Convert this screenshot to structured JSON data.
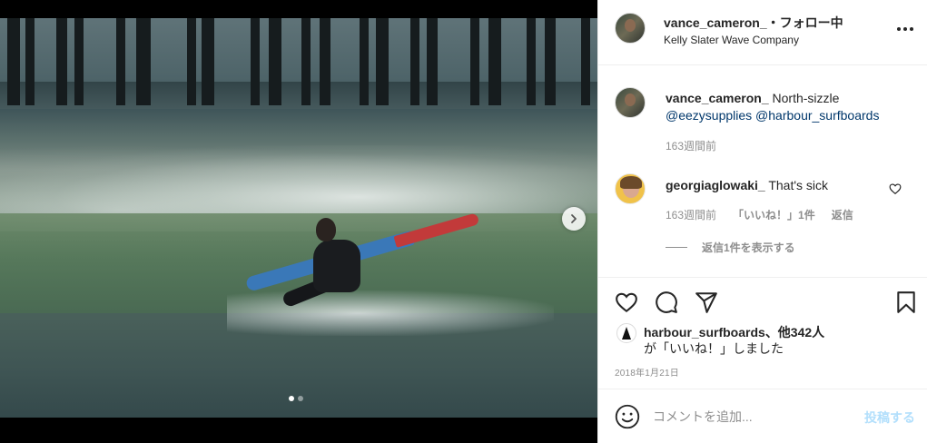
{
  "post": {
    "username": "vance_cameron_",
    "follow_status": "・フォロー中",
    "location": "Kelly Slater Wave Company"
  },
  "caption": {
    "username": "vance_cameron_",
    "text": "North-sizzle",
    "mention1": "@eezysupplies",
    "mention2": "@harbour_surfboards",
    "time": "163週間前"
  },
  "comment": {
    "username": "georgiaglowaki_",
    "text": "That's sick",
    "time": "163週間前",
    "likes": "「いいね！」1件",
    "reply": "返信",
    "view_replies": "返信1件を表示する"
  },
  "likes": {
    "first_user": "harbour_surfboards",
    "others": "、他342人",
    "suffix": "が「いいね！」しました"
  },
  "date": "2018年1月21日",
  "input": {
    "placeholder": "コメントを追加...",
    "post_label": "投稿する"
  },
  "carousel": {
    "count": 2,
    "current": 1
  },
  "icons": [
    "more-icon",
    "heart-icon",
    "comment-icon",
    "share-icon",
    "bookmark-icon",
    "emoji-icon",
    "chevron-right-icon"
  ]
}
